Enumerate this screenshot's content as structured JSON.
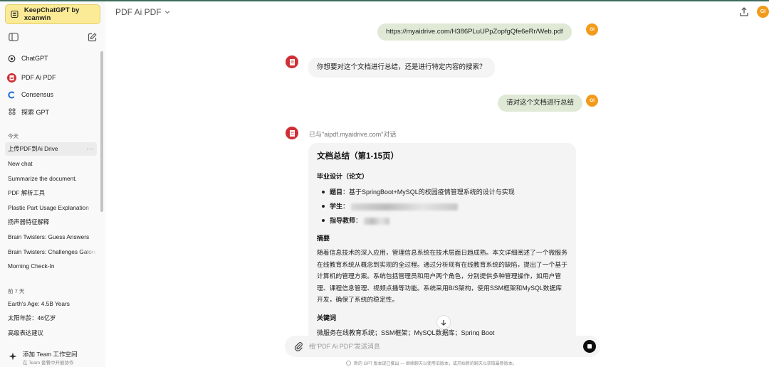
{
  "sidebar": {
    "keep_button": "KeepChatGPT by xcanwin",
    "gpts": [
      {
        "label": "ChatGPT",
        "icon": "openai-icon"
      },
      {
        "label": "PDF Ai PDF",
        "icon": "pdf-ai-icon"
      },
      {
        "label": "Consensus",
        "icon": "consensus-icon"
      },
      {
        "label": "探索 GPT",
        "icon": "grid-icon"
      }
    ],
    "today_label": "今天",
    "today": [
      "上传PDF到Ai Drive",
      "New chat",
      "Summarize the document.",
      "PDF 解析工具",
      "Plastic Part Usage Explanation",
      "扬声器特征解释",
      "Brain Twisters: Guess Answers",
      "Brain Twisters: Challenges Galore",
      "Morning Check-In"
    ],
    "active_more": "···",
    "week_label": "前 7 天",
    "week": [
      "Earth's Age: 4.5B Years",
      "太阳年龄：46亿岁",
      "高级表达建议"
    ],
    "team_title": "添加 Team 工作空间",
    "team_sub": "在 Team 套餐中开展协作"
  },
  "header": {
    "title": "PDF Ai PDF",
    "avatar": "GI"
  },
  "chat": {
    "user_msg_1": "https://myaidrive.com/H386PLuUPpZopfgQfe6eRr/Web.pdf",
    "bot_msg_1": "你想要对这个文档进行总结，还是进行特定内容的搜索？",
    "user_msg_2": "请对这个文档进行总结",
    "talk_label": "已与\"aipdf.myaidrive.com\"对话",
    "avatar": "GI",
    "answer": {
      "title": "文档总结（第1-15页）",
      "section1": "毕业设计（论文）",
      "items": [
        {
          "label": "题目",
          "value": "：基于SpringBoot+MySQL的校园疫情管理系统的设计与实现"
        },
        {
          "label": "学生",
          "value": "："
        },
        {
          "label": "指导教师",
          "value": "："
        }
      ],
      "abstract_title": "摘要",
      "abstract": "随着信息技术的深入应用，管理信息系统在技术层面日趋成熟。本文详细阐述了一个微服务在线教育系统从概念到实现的全过程。通过分析现有在线教育系统的缺陷，提出了一个基于计算机的管理方案。系统包括管理员和用户两个角色，分别提供多种管理操作，如用户管理、课程信息管理、视频点播等功能。系统采用B/S架构，使用SSM框架和MySQL数据库开发，确保了系统的稳定性。",
      "keywords_title": "关键词",
      "keywords": "微服务在线教育系统；SSM框架；MySQL数据库；Spring Boot"
    }
  },
  "composer": {
    "placeholder": "给\"PDF Ai PDF\"发送消息",
    "footnote": "新的 GPT 版本现已推出 — 继续聊天以使用旧版本，或开始新的聊天以获取最新版本。"
  }
}
